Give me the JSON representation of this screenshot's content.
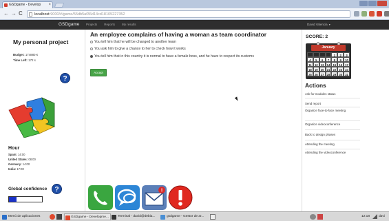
{
  "browser": {
    "tab_title": "GSDgame - Develop",
    "tab_close": "×",
    "url_host": "localhost",
    "url_rest": ":9000/#/game/55db5af36d14cd18105227352",
    "back": "←",
    "forward": "→",
    "reload": "C"
  },
  "appbar": {
    "brand": "GSDgame",
    "links": [
      "Projects",
      "Reports",
      "My results"
    ],
    "user": "David Valencia",
    "user_caret": "▾"
  },
  "left": {
    "title": "My personal project",
    "budget_label": "Budget:",
    "budget_value": "174880 €",
    "timeleft_label": "Time Left:",
    "timeleft_value": "172 s",
    "help": "?",
    "hour_title": "Hour",
    "zones": [
      {
        "label": "Spain:",
        "value": "14:00"
      },
      {
        "label": "United States:",
        "value": "08:00"
      },
      {
        "label": "Germany:",
        "value": "14:00"
      },
      {
        "label": "India:",
        "value": "17:00"
      }
    ],
    "global_confidence": "Global confidence",
    "confidence_fraction": 0.22,
    "confidence_color": "#1a32c8"
  },
  "center": {
    "question": "An employee complains of having a woman as team coordinator",
    "options": [
      "You tell him that he will be changed to another team",
      "You ask him to give a chance to her to check how it works",
      "You tell him that in this country it is normal to have a female boss, and he have to respect its customs"
    ],
    "selected_index": 2,
    "accept": "Accept",
    "icons": [
      "phone-icon",
      "chat-icon",
      "mail-icon",
      "alert-icon"
    ]
  },
  "right": {
    "score": "SCORE: 2",
    "month": "January",
    "calendar_days": [
      "",
      "",
      "",
      "",
      "1",
      "2",
      "3",
      "4",
      "5",
      "6",
      "7",
      "8",
      "9",
      "10",
      "11",
      "12",
      "13",
      "14",
      "15",
      "16",
      "17",
      "18",
      "19",
      "20",
      "21",
      "22",
      "23",
      "24",
      "25",
      "26",
      "27",
      "28",
      "29",
      "30",
      "31"
    ],
    "actions_title": "Actions",
    "actions": [
      "Ask for modules status",
      "Send report",
      "Organize face-to-face meeting",
      "Organize videoconference",
      "Back to design phases",
      "Attending the meeting",
      "Attending the videoconference"
    ]
  },
  "taskbar": {
    "start": "Menú de aplicaciones",
    "items": [
      "GSDgame - Developme...",
      "Terminal - david@debia...",
      "gsdgame - Gestor de ar..."
    ],
    "clock": "12:18",
    "tray_user": "davi"
  },
  "colors": {
    "appbar": "#2e2e2e",
    "accept": "#47a447",
    "help": "#1f4fa8",
    "calendar_header": "#c0392b"
  }
}
